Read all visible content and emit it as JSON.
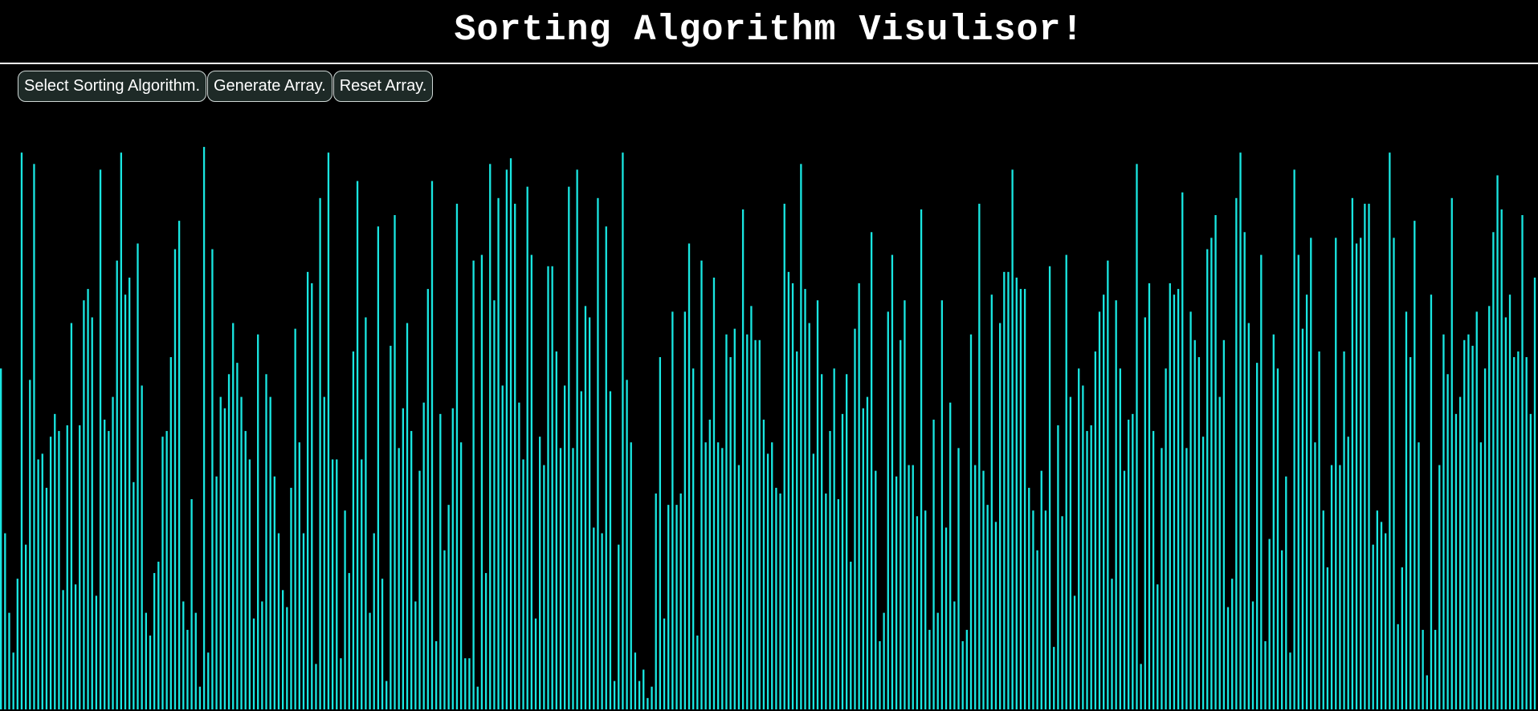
{
  "header": {
    "title": "Sorting Algorithm Visulisor!"
  },
  "toolbar": {
    "select_algorithm_label": "Select Sorting Algorithm.",
    "generate_array_label": "Generate Array.",
    "reset_array_label": "Reset Array."
  },
  "colors": {
    "background": "#000000",
    "bar": "#19e6e1",
    "title_text": "#ffffff",
    "button_bg": "#1e2a27",
    "button_border": "#cfd8d6"
  },
  "array": {
    "bar_count": 350,
    "values": [
      60,
      31,
      17,
      10,
      23,
      98,
      29,
      58,
      96,
      44,
      45,
      39,
      48,
      52,
      49,
      21,
      50,
      68,
      22,
      50,
      72,
      74,
      69,
      20,
      95,
      51,
      49,
      55,
      79,
      98,
      73,
      76,
      40,
      82,
      57,
      17,
      13,
      24,
      26,
      48,
      49,
      62,
      81,
      86,
      19,
      14,
      37,
      17,
      4,
      99,
      10,
      81,
      41,
      55,
      53,
      59,
      68,
      61,
      55,
      49,
      44,
      16,
      66,
      19,
      59,
      55,
      41,
      31,
      21,
      18,
      39,
      67,
      47,
      31,
      77,
      75,
      8,
      90,
      55,
      98,
      44,
      44,
      9,
      35,
      24,
      63,
      93,
      44,
      69,
      17,
      31,
      85,
      23,
      5,
      64,
      87,
      46,
      53,
      68,
      49,
      19,
      42,
      54,
      74,
      93,
      12,
      52,
      28,
      36,
      53,
      89,
      47,
      9,
      9,
      79,
      4,
      80,
      24,
      96,
      72,
      90,
      57,
      95,
      97,
      89,
      54,
      44,
      92,
      80,
      16,
      48,
      43,
      78,
      78,
      63,
      46,
      57,
      92,
      46,
      95,
      56,
      71,
      69,
      32,
      90,
      31,
      85,
      56,
      5,
      29,
      98,
      58,
      47,
      10,
      5,
      7,
      2,
      4,
      38,
      62,
      16,
      36,
      70,
      36,
      38,
      70,
      82,
      60,
      13,
      79,
      47,
      51,
      76,
      47,
      46,
      66,
      62,
      67,
      43,
      88,
      66,
      71,
      65,
      65,
      51,
      45,
      47,
      39,
      38,
      89,
      77,
      75,
      63,
      96,
      74,
      68,
      45,
      72,
      59,
      38,
      49,
      60,
      37,
      52,
      59,
      26,
      67,
      75,
      53,
      55,
      84,
      42,
      12,
      17,
      70,
      80,
      41,
      65,
      72,
      43,
      43,
      34,
      88,
      35,
      14,
      51,
      17,
      72,
      32,
      54,
      19,
      46,
      12,
      14,
      66,
      43,
      89,
      42,
      36,
      73,
      33,
      68,
      77,
      77,
      95,
      76,
      74,
      74,
      39,
      35,
      28,
      42,
      35,
      78,
      11,
      50,
      34,
      80,
      55,
      20,
      60,
      57,
      49,
      50,
      63,
      70,
      73,
      79,
      23,
      72,
      60,
      42,
      51,
      52,
      96,
      8,
      69,
      75,
      49,
      22,
      46,
      60,
      75,
      73,
      74,
      91,
      46,
      70,
      65,
      62,
      48,
      81,
      83,
      87,
      55,
      65,
      18,
      23,
      90,
      98,
      84,
      68,
      19,
      61,
      80,
      12,
      30,
      66,
      60,
      28,
      41,
      10,
      95,
      80,
      67,
      73,
      83,
      47,
      63,
      35,
      25,
      43,
      83,
      43,
      63,
      48,
      90,
      82,
      83,
      89,
      89,
      29,
      35,
      33,
      31,
      98,
      83,
      15,
      25,
      70,
      62,
      86,
      47,
      14,
      6,
      73,
      14,
      43,
      66,
      59,
      90,
      52,
      55,
      65,
      66,
      64,
      70,
      47,
      60,
      71,
      84,
      94,
      88,
      69,
      73,
      62,
      63,
      87,
      62,
      52,
      76
    ],
    "max_value": 100
  }
}
